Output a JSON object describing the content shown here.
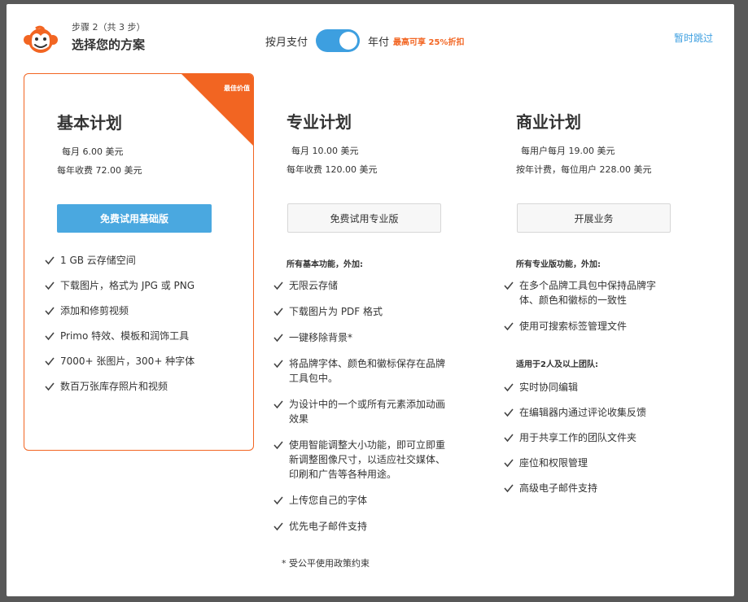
{
  "header": {
    "step": "步骤 2（共 3 步）",
    "title": "选择您的方案",
    "skip": "暂时跳过"
  },
  "billing": {
    "monthly_label": "按月支付",
    "yearly_label": "年付",
    "discount": "最高可享 25%折扣",
    "yearly_selected": true
  },
  "colors": {
    "accent_blue": "#3d9fe0",
    "accent_orange": "#f26522"
  },
  "plans": {
    "basic": {
      "ribbon": "最佳价值",
      "name": "基本计划",
      "price_monthly": "每月 6.00 美元",
      "price_yearly": "每年收费 72.00 美元",
      "cta": "免费试用基础版",
      "features": [
        "1 GB 云存储空间",
        "下载图片，格式为 JPG 或 PNG",
        "添加和修剪视频",
        "Primo 特效、模板和润饰工具",
        "7000+ 张图片，300+ 种字体",
        "数百万张库存照片和视频"
      ]
    },
    "pro": {
      "name": "专业计划",
      "price_monthly": "每月 10.00 美元",
      "price_yearly": "每年收费 120.00 美元",
      "cta": "免费试用专业版",
      "section": "所有基本功能，外加:",
      "features": [
        "无限云存储",
        "下载图片为 PDF 格式",
        "一键移除背景*",
        "将品牌字体、颜色和徽标保存在品牌工具包中。",
        "为设计中的一个或所有元素添加动画效果",
        "使用智能调整大小功能，即可立即重新调整图像尺寸，以适应社交媒体、印刷和广告等各种用途。",
        "上传您自己的字体",
        "优先电子邮件支持"
      ],
      "footnote": "* 受公平使用政策约束"
    },
    "business": {
      "name": "商业计划",
      "price_monthly": "每用户每月 19.00 美元",
      "price_yearly": "按年计费，每位用户 228.00 美元",
      "cta": "开展业务",
      "section": "所有专业版功能，外加:",
      "features": [
        "在多个品牌工具包中保持品牌字体、颜色和徽标的一致性",
        "使用可搜索标签管理文件"
      ],
      "team_section": "适用于2人及以上团队:",
      "team_features": [
        "实时协同编辑",
        "在编辑器内通过评论收集反馈",
        "用于共享工作的团队文件夹",
        "座位和权限管理",
        "高级电子邮件支持"
      ]
    }
  }
}
